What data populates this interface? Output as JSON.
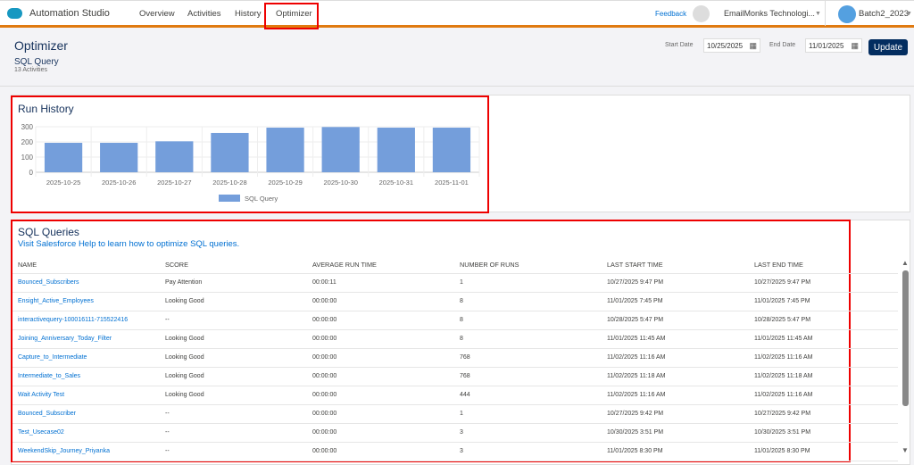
{
  "header": {
    "app_title": "Automation Studio",
    "nav": [
      "Overview",
      "Activities",
      "History",
      "Optimizer"
    ],
    "feedback": "Feedback",
    "org": "EmailMonks Technologi...",
    "user": "Batch2_2023"
  },
  "page": {
    "title": "Optimizer",
    "subtitle": "SQL Query",
    "count": "13 Activities",
    "start_label": "Start Date",
    "start_date": "10/25/2025",
    "end_label": "End Date",
    "end_date": "11/01/2025",
    "update": "Update"
  },
  "chart_data": {
    "type": "bar",
    "title": "Run History",
    "categories": [
      "2025-10-25",
      "2025-10-26",
      "2025-10-27",
      "2025-10-28",
      "2025-10-29",
      "2025-10-30",
      "2025-10-31",
      "2025-11-01"
    ],
    "series": [
      {
        "name": "SQL Query",
        "values": [
          194,
          194,
          204,
          259,
          294,
          298,
          294,
          294
        ]
      }
    ],
    "ylim": [
      0,
      300
    ],
    "yticks": [
      "0",
      "100",
      "200",
      "300"
    ],
    "legend": "bottom",
    "color": "#749edb"
  },
  "queries": {
    "title": "SQL Queries",
    "help": "Visit Salesforce Help to learn how to optimize SQL queries.",
    "columns": [
      "NAME",
      "SCORE",
      "AVERAGE RUN TIME",
      "NUMBER OF RUNS",
      "LAST START TIME",
      "LAST END TIME"
    ],
    "rows": [
      [
        "Bounced_Subscribers",
        "Pay Attention",
        "00:00:11",
        "1",
        "10/27/2025 9:47 PM",
        "10/27/2025 9:47 PM"
      ],
      [
        "Ensight_Active_Employees",
        "Looking Good",
        "00:00:00",
        "8",
        "11/01/2025 7:45 PM",
        "11/01/2025 7:45 PM"
      ],
      [
        "interactivequery-100016111-715522416",
        "--",
        "00:00:00",
        "8",
        "10/28/2025 5:47 PM",
        "10/28/2025 5:47 PM"
      ],
      [
        "Joining_Anniversary_Today_Filter",
        "Looking Good",
        "00:00:00",
        "8",
        "11/01/2025 11:45 AM",
        "11/01/2025 11:45 AM"
      ],
      [
        "Capture_to_Intermediate",
        "Looking Good",
        "00:00:00",
        "768",
        "11/02/2025 11:16 AM",
        "11/02/2025 11:16 AM"
      ],
      [
        "Intermediate_to_Sales",
        "Looking Good",
        "00:00:00",
        "768",
        "11/02/2025 11:18 AM",
        "11/02/2025 11:18 AM"
      ],
      [
        "Wait Activity Test",
        "Looking Good",
        "00:00:00",
        "444",
        "11/02/2025 11:16 AM",
        "11/02/2025 11:16 AM"
      ],
      [
        "Bounced_Subscriber",
        "--",
        "00:00:00",
        "1",
        "10/27/2025 9:42 PM",
        "10/27/2025 9:42 PM"
      ],
      [
        "Test_Usecase02",
        "--",
        "00:00:00",
        "3",
        "10/30/2025 3:51 PM",
        "10/30/2025 3:51 PM"
      ],
      [
        "WeekendSkip_Journey_Priyanka",
        "--",
        "00:00:00",
        "3",
        "11/01/2025 8:30 PM",
        "11/01/2025 8:30 PM"
      ]
    ]
  }
}
